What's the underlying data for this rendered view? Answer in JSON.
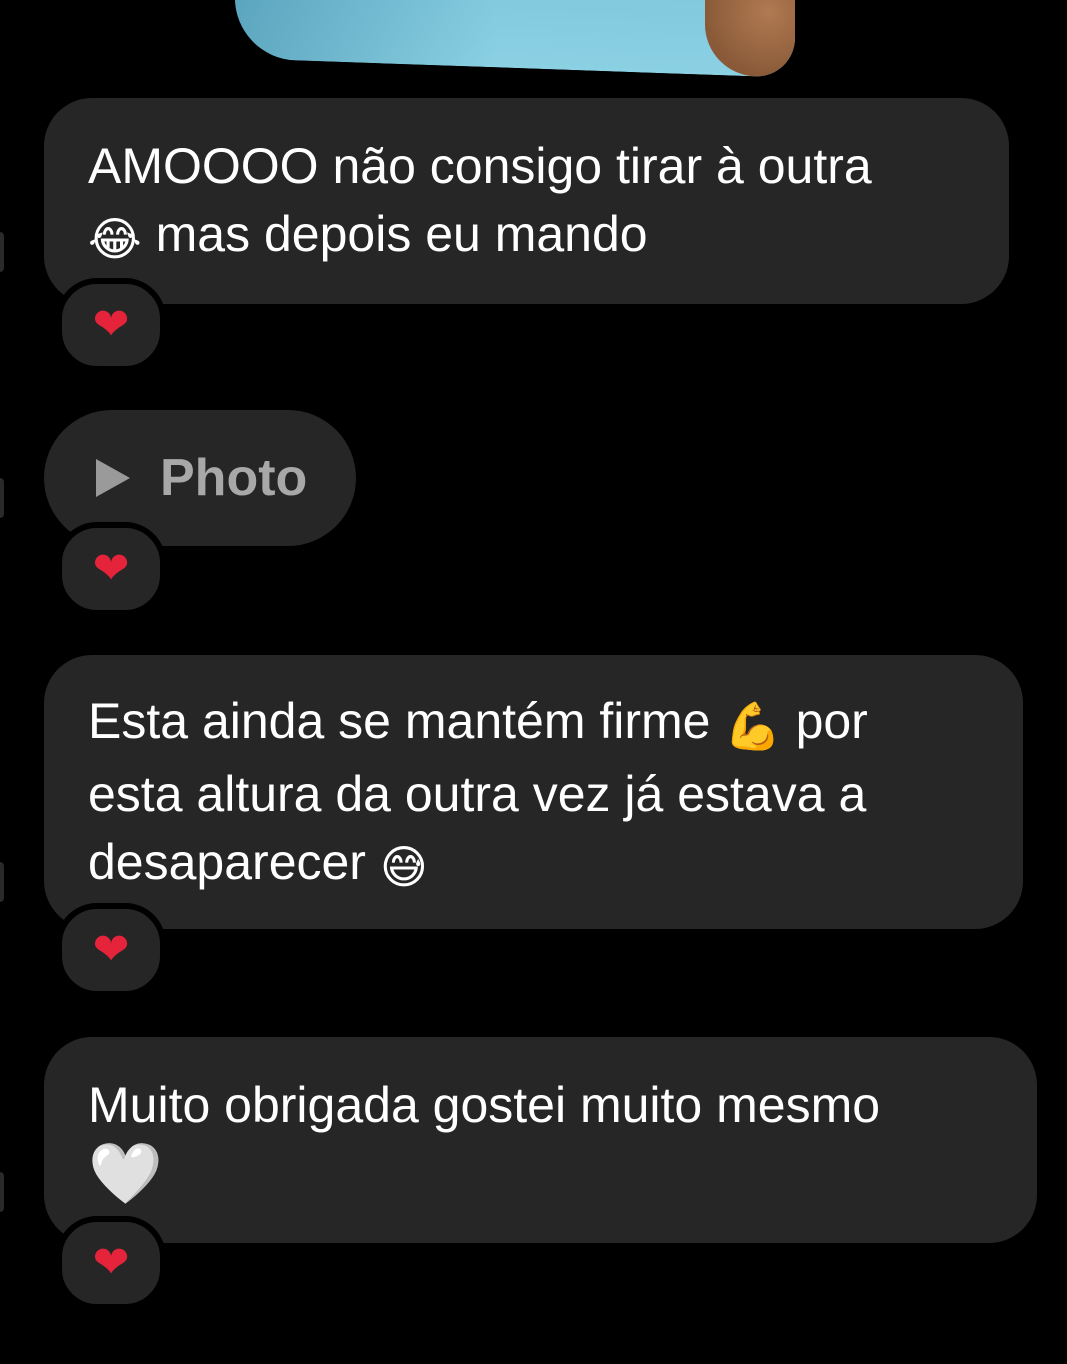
{
  "messages": [
    {
      "type": "text",
      "line1": "AMOOOO não consigo tirar à outra",
      "line2_emoji": "😂",
      "line2_text": " mas depois eu mando",
      "reaction": "❤"
    },
    {
      "type": "photo",
      "label": "Photo",
      "reaction": "❤"
    },
    {
      "type": "text",
      "line1_text": "Esta ainda se mantém firme ",
      "line1_emoji": "💪",
      "line1_tail": " por",
      "line2": "esta altura da outra vez já estava a",
      "line3_text": "desaparecer ",
      "line3_emoji": "😅",
      "reaction": "❤"
    },
    {
      "type": "text",
      "line1": "Muito obrigada gostei muito mesmo",
      "line2_emoji": "🤍",
      "reaction": "❤"
    }
  ],
  "colors": {
    "background": "#000000",
    "bubble": "#262626",
    "heart": "#e5243b"
  }
}
